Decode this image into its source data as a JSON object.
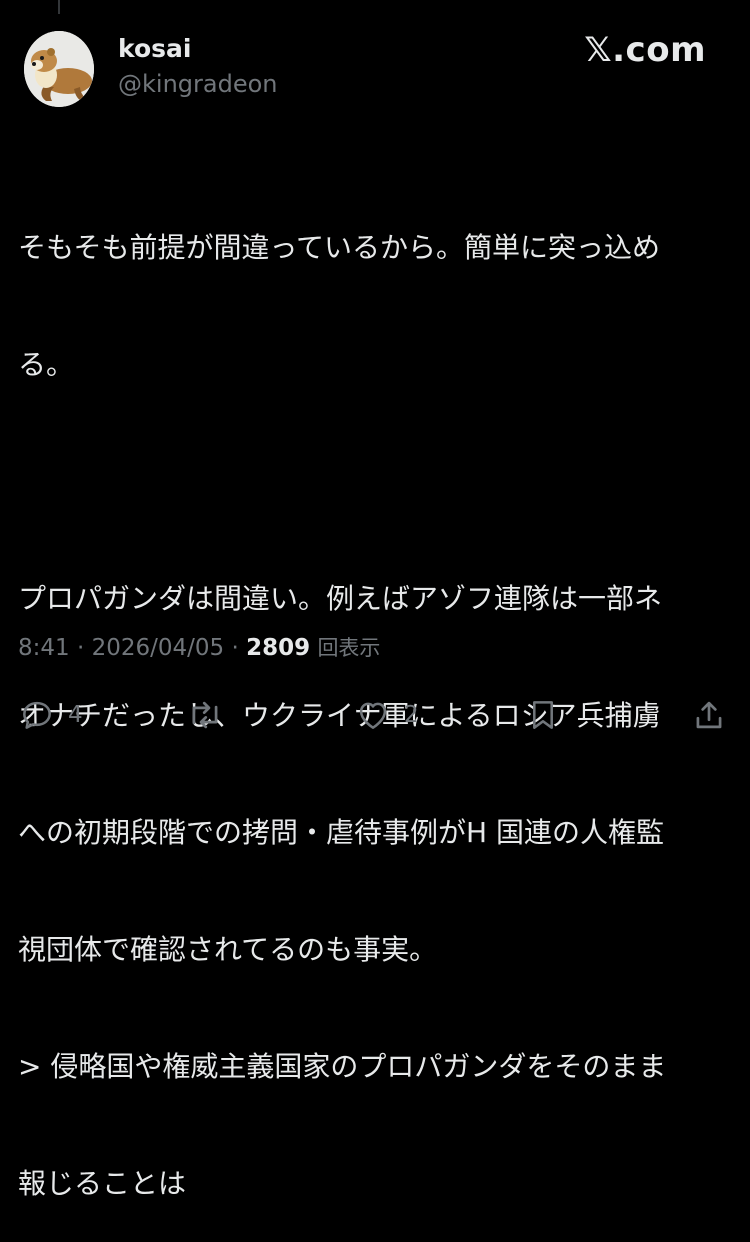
{
  "user": {
    "display_name": "kosai",
    "handle": "@kingradeon"
  },
  "brand": {
    "logo_text": "𝕏.com"
  },
  "post": {
    "lines": [
      "そもそも前提が間違っているから。簡単に突っ込め",
      "る。",
      "",
      "プロパガンダは間違い。例えばアゾフ連隊は一部ネ",
      "オナチだったし、ウクライナ軍によるロシア兵捕虜",
      "への初期段階での拷問・虐待事例がH 国連の人権監",
      "視団体で確認されてるのも事実。",
      "> 侵略国や権威主義国家のプロパガンダをそのまま",
      "報じることは"
    ]
  },
  "meta": {
    "time": "8:41",
    "date": "2026/04/05",
    "views_count": "2809",
    "views_label": "回表示"
  },
  "actions": {
    "reply_count": "4",
    "retweet_count": "",
    "like_count": "2"
  },
  "colors": {
    "background": "#000000",
    "text": "#e7e9ea",
    "secondary": "#71767b"
  }
}
